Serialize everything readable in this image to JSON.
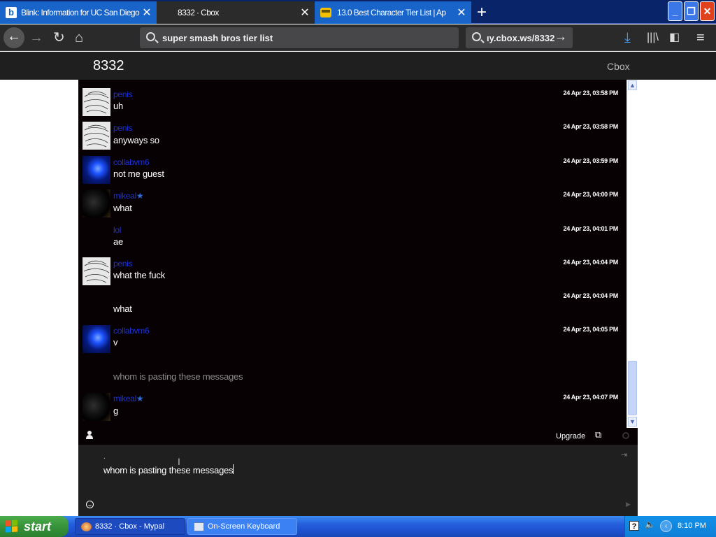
{
  "browser": {
    "tabs": [
      {
        "label": "Blink: Information for UC San Diego",
        "favicon": "b",
        "active": false
      },
      {
        "label": "8332 · Cbox",
        "active": true
      },
      {
        "label": "13.0 Best Character Tier List | Ap",
        "active": false
      }
    ],
    "new_tab": "+",
    "search_value": "super smash bros tier list",
    "url_value": "ıy.cbox.ws/8332"
  },
  "page": {
    "title": "8332",
    "brand": "Cbox"
  },
  "chat": {
    "username_color": "#1f32d6",
    "messages": [
      {
        "user": "penis",
        "text": "uh",
        "time": "24 Apr 23, 03:58 PM",
        "avatar": "sketch",
        "star": false
      },
      {
        "user": "penis",
        "text": "anyways so",
        "time": "24 Apr 23, 03:58 PM",
        "avatar": "sketch",
        "star": false
      },
      {
        "user": "collabvm6",
        "text": "not me guest",
        "time": "24 Apr 23, 03:59 PM",
        "avatar": "jellyfish",
        "star": false
      },
      {
        "user": "mikeal",
        "text": "what",
        "time": "24 Apr 23, 04:00 PM",
        "avatar": "dark",
        "star": true
      },
      {
        "user": "lol",
        "text": "ae",
        "time": "24 Apr 23, 04:01 PM",
        "avatar": "none",
        "star": false
      },
      {
        "user": "penis",
        "text": "what the fuck",
        "time": "24 Apr 23, 04:04 PM",
        "avatar": "sketch",
        "star": false
      },
      {
        "user": "",
        "text": "what",
        "time": "24 Apr 23, 04:04 PM",
        "avatar": "none",
        "star": false
      },
      {
        "user": "collabvm6",
        "text": "v",
        "time": "24 Apr 23, 04:05 PM",
        "avatar": "jellyfish",
        "star": false
      },
      {
        "user": "",
        "text": "whom is pasting these messages",
        "time": "",
        "avatar": "none",
        "star": false,
        "pending": true
      },
      {
        "user": "mikeal",
        "text": "g",
        "time": "24 Apr 23, 04:07 PM",
        "avatar": "dark",
        "star": true
      }
    ]
  },
  "toolbar": {
    "upgrade": "Upgrade"
  },
  "composer": {
    "value": "whom is pasting these messages",
    "typing_indicator": "."
  },
  "taskbar": {
    "start": "start",
    "tasks": [
      {
        "label": "8332 · Cbox - Mypal"
      },
      {
        "label": "On-Screen Keyboard"
      }
    ],
    "clock": "8:10 PM"
  }
}
